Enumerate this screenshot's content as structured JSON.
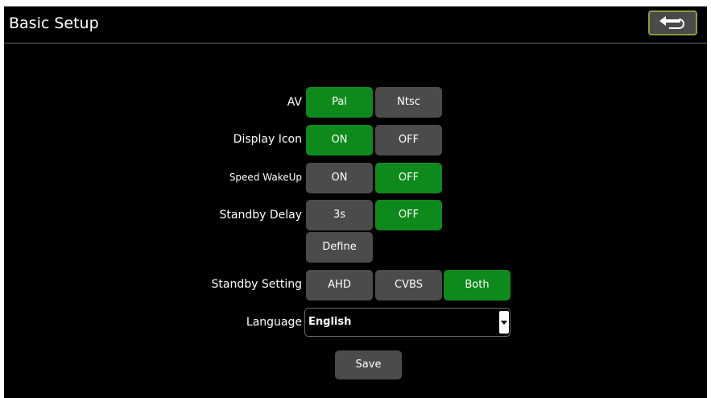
{
  "header": {
    "title": "Basic Setup",
    "back_icon": "back-arrow-icon"
  },
  "colors": {
    "active": "#0e8a1c",
    "inactive": "#4b4b4b",
    "background": "#000000"
  },
  "settings": {
    "av": {
      "label": "AV",
      "options": [
        "Pal",
        "Ntsc"
      ],
      "selected": "Pal"
    },
    "display_icon": {
      "label": "Display Icon",
      "options": [
        "ON",
        "OFF"
      ],
      "selected": "ON"
    },
    "speed_wakeup": {
      "label": "Speed WakeUp",
      "options": [
        "ON",
        "OFF"
      ],
      "selected": "OFF"
    },
    "standby_delay": {
      "label": "Standby Delay",
      "options": [
        "3s",
        "OFF",
        "Define"
      ],
      "selected": "OFF"
    },
    "standby_setting": {
      "label": "Standby Setting",
      "options": [
        "AHD",
        "CVBS",
        "Both"
      ],
      "selected": "Both"
    },
    "language": {
      "label": "Language",
      "value": "English"
    }
  },
  "actions": {
    "save_label": "Save"
  }
}
